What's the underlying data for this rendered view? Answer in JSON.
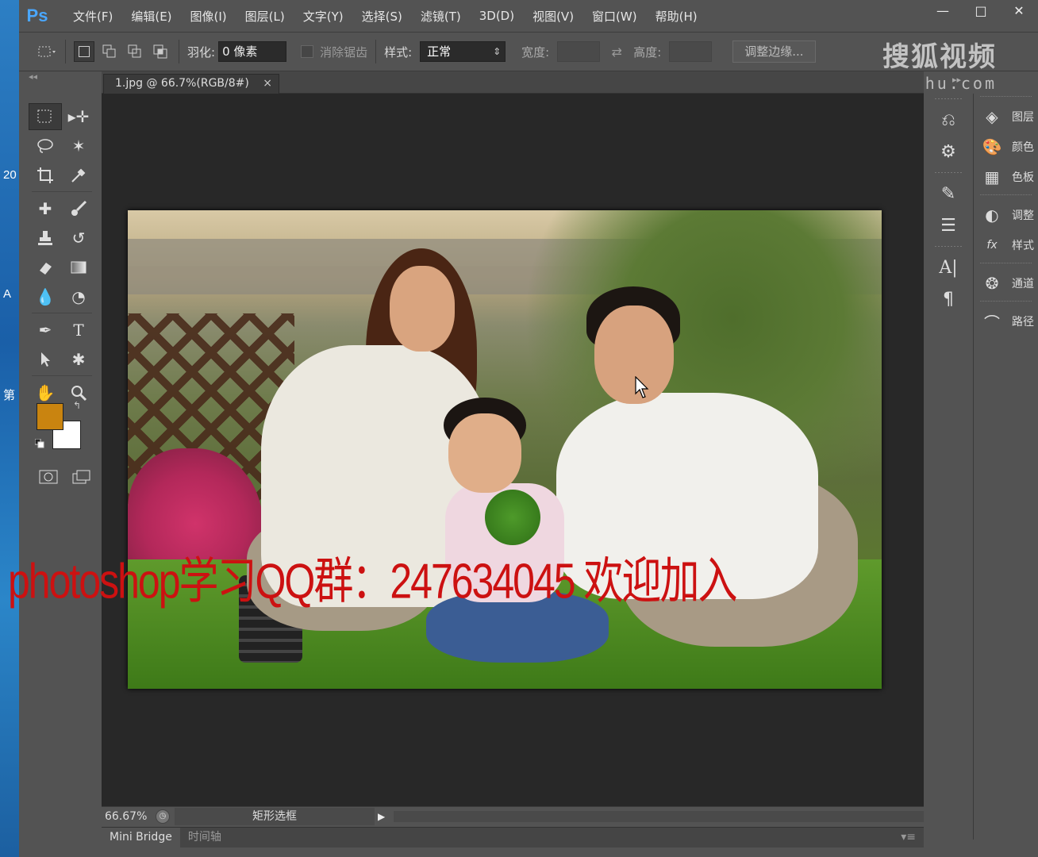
{
  "desktop": {
    "labels": [
      "20",
      "A",
      "第"
    ]
  },
  "app": {
    "logo": "Ps",
    "menu": [
      "文件(F)",
      "编辑(E)",
      "图像(I)",
      "图层(L)",
      "文字(Y)",
      "选择(S)",
      "滤镜(T)",
      "3D(D)",
      "视图(V)",
      "窗口(W)",
      "帮助(H)"
    ],
    "window_buttons": [
      "—",
      "□",
      "✕"
    ]
  },
  "options": {
    "feather_label": "羽化:",
    "feather_value": "0 像素",
    "antialias_label": "消除锯齿",
    "style_label": "样式:",
    "style_value": "正常",
    "width_label": "宽度:",
    "height_label": "高度:",
    "refine_label": "调整边缘..."
  },
  "watermark": {
    "brand": "搜狐视频",
    "url": "tv.sohu.com"
  },
  "document": {
    "tab_title": "1.jpg @ 66.7%(RGB/8#)",
    "tab_close": "×",
    "overlay_text": "photoshop学习QQ群：247634045 欢迎加入"
  },
  "colors": {
    "foreground": "#c98410",
    "background": "#ffffff"
  },
  "status": {
    "zoom": "66.67%",
    "current_tool": "矩形选框",
    "arrow": "▶"
  },
  "bottom_tabs": [
    "Mini Bridge",
    "时间轴"
  ],
  "right_panels": [
    {
      "label": "图层",
      "icon": "layers-icon"
    },
    {
      "label": "颜色",
      "icon": "color-icon"
    },
    {
      "label": "色板",
      "icon": "swatches-icon"
    },
    {
      "label": "调整",
      "icon": "adjustments-icon"
    },
    {
      "label": "样式",
      "icon": "styles-icon"
    },
    {
      "label": "通道",
      "icon": "channels-icon"
    },
    {
      "label": "路径",
      "icon": "paths-icon"
    }
  ]
}
